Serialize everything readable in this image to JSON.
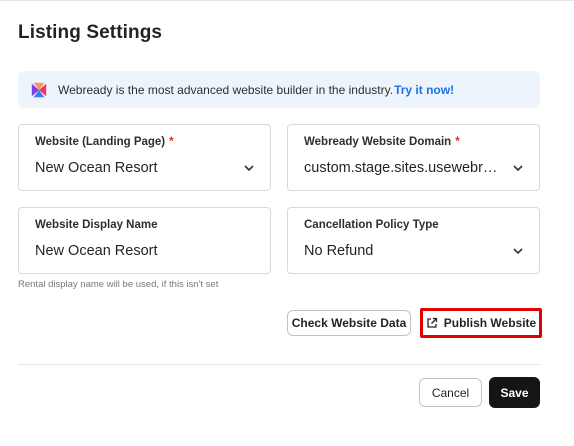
{
  "dialog": {
    "title": "Listing Settings"
  },
  "banner": {
    "text": "Webready is the most advanced website builder in the industry.",
    "cta": "Try it now!",
    "logo_icon": "webready-logo-icon"
  },
  "fields": {
    "website": {
      "label": "Website (Landing Page)",
      "required": "*",
      "value": "New Ocean Resort",
      "icon": "chevron-down-icon"
    },
    "domain": {
      "label": "Webready Website Domain",
      "required": "*",
      "value": "custom.stage.sites.usewebready.com",
      "icon": "chevron-down-icon"
    },
    "display_name": {
      "label": "Website Display Name",
      "value": "New Ocean Resort",
      "helper": "Rental display name will be used, if this isn't set"
    },
    "cancellation": {
      "label": "Cancellation Policy Type",
      "value": "No Refund",
      "icon": "chevron-down-icon"
    }
  },
  "actions": {
    "check_label": "Check Website Data",
    "publish_label": "Publish Website",
    "publish_icon": "external-link-icon",
    "cancel_label": "Cancel",
    "save_label": "Save"
  },
  "colors": {
    "accent_link": "#1a73e8",
    "highlight_border": "#e00000",
    "save_bg": "#151515",
    "banner_bg": "#eef4fb",
    "required": "#d32f2f"
  }
}
